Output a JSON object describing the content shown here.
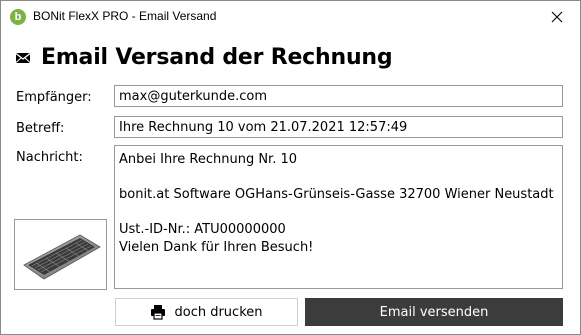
{
  "window": {
    "title": "BONit FlexX PRO - Email Versand",
    "app_icon": "bonit-logo-icon",
    "close_icon": "close-icon"
  },
  "heading": {
    "icon": "mail-icon",
    "text": "Email Versand der Rechnung"
  },
  "form": {
    "recipient_label": "Empfänger:",
    "recipient_value": "max@guterkunde.com",
    "subject_label": "Betreff:",
    "subject_value": "Ihre Rechnung 10 vom 21.07.2021 12:57:49",
    "message_label": "Nachricht:",
    "message_lines": [
      "Anbei Ihre Rechnung Nr. 10",
      "",
      "bonit.at Software OGHans-Grünseis-Gasse 32700 Wiener Neustadt",
      "",
      "Ust.-ID-Nr.: ATU00000000",
      "Vielen Dank für Ihren Besuch!"
    ]
  },
  "image": {
    "icon": "keyboard-image"
  },
  "buttons": {
    "print_icon": "printer-icon",
    "print_label": "doch drucken",
    "send_label": "Email versenden"
  },
  "colors": {
    "send_button": "#3c3c3c",
    "app_icon": "#7cb342"
  }
}
